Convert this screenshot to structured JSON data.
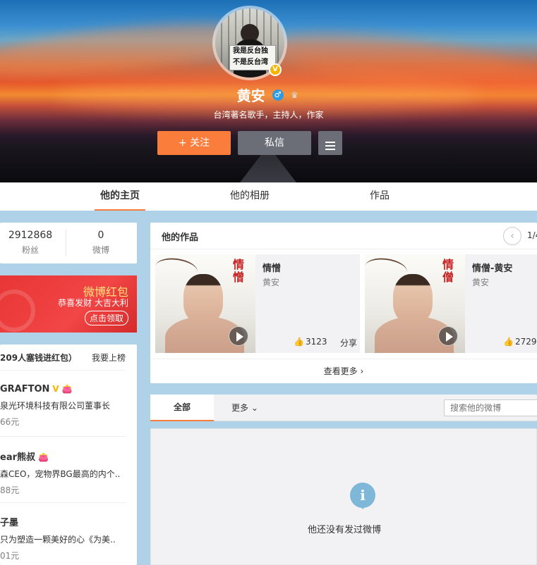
{
  "profile": {
    "name": "黄安",
    "description": "台湾著名歌手，主持人，作家",
    "avatar_sign_line1": "我是反台独",
    "avatar_sign_line2": "不是反台湾",
    "verified_badge": "V",
    "gender_icon": "male-icon",
    "follow_label": "+ 关注",
    "message_label": "私信"
  },
  "tabs": [
    {
      "label": "他的主页",
      "active": true
    },
    {
      "label": "他的相册",
      "active": false
    },
    {
      "label": "作品",
      "active": false
    }
  ],
  "stats": {
    "fans_count": "2912868",
    "fans_label": "粉丝",
    "posts_count": "0",
    "posts_label": "微博"
  },
  "red_packet": {
    "title": "微博红包",
    "subtitle": "恭喜发财 大吉大利",
    "cta": "点击领取"
  },
  "ranking": {
    "header": "209人塞钱进红包）",
    "join": "我要上榜",
    "items": [
      {
        "name": "GRAFTON",
        "desc": "泉光环境科技有限公司董事长",
        "amount": "66元"
      },
      {
        "name": "ear熊叔",
        "desc": "森CEO，宠物界BG最高的内个..",
        "amount": "88元"
      },
      {
        "name": "子墨",
        "desc": "只为塑造一颗美好的心《为美..",
        "amount": "01元"
      }
    ]
  },
  "works": {
    "title": "他的作品",
    "page": "1/4",
    "more": "查看更多",
    "items": [
      {
        "title": "情憎",
        "artist": "黄安",
        "likes": "3123",
        "share": "分享",
        "seal": "情憎"
      },
      {
        "title": "情僧-黄安",
        "artist": "黄安",
        "likes": "2729",
        "share": "",
        "seal": "情僧"
      }
    ]
  },
  "feed": {
    "tab_all": "全部",
    "tab_more": "更多",
    "search_placeholder": "搜索他的微博",
    "empty_message": "他还没有发过微博"
  },
  "colors": {
    "accent": "#fa7d3c",
    "verified": "#f7b500",
    "page_bg": "#b0d2e8"
  }
}
